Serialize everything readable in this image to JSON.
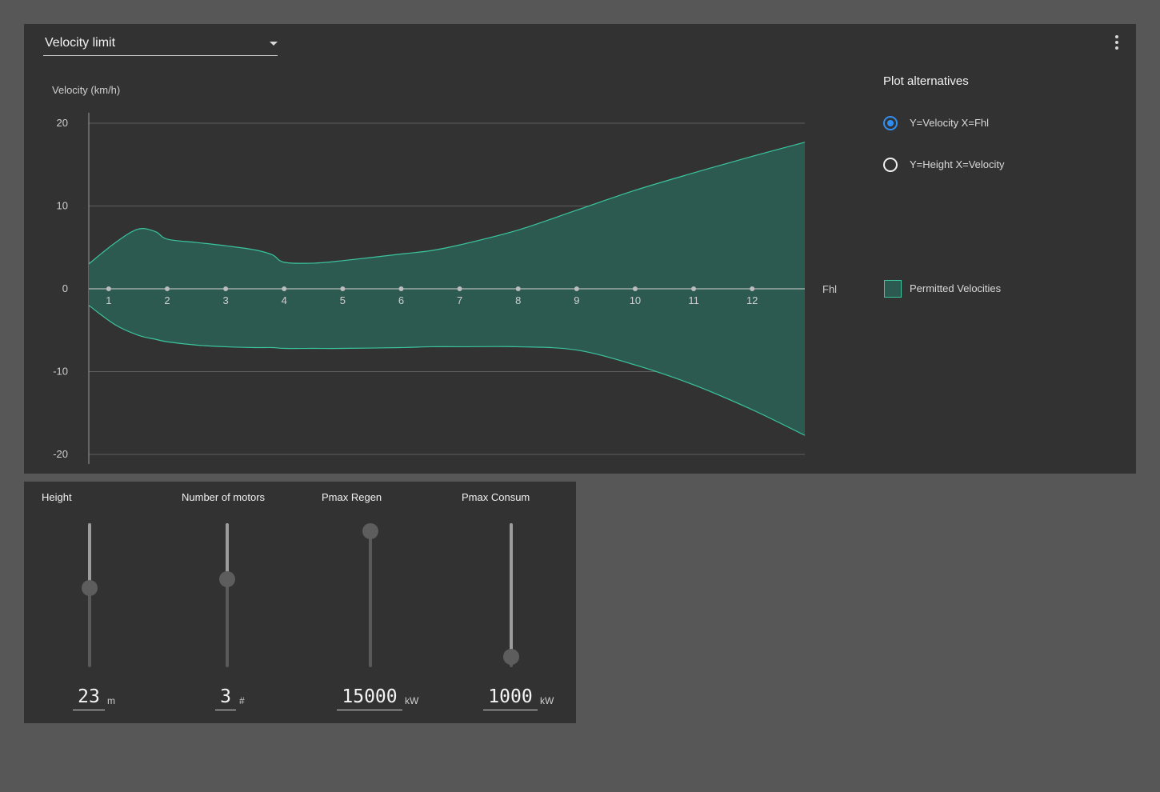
{
  "chart_selector": {
    "selected": "Velocity limit"
  },
  "menu_icon": "more-vertical-icon",
  "plot_alternatives": {
    "title": "Plot alternatives",
    "options": [
      {
        "label": "Y=Velocity X=Fhl",
        "checked": true
      },
      {
        "label": "Y=Height X=Velocity",
        "checked": false
      }
    ]
  },
  "legend": {
    "label": "Permitted Velocities",
    "color": "#2d5a50",
    "stroke": "#3ac49d"
  },
  "chart_data": {
    "type": "area",
    "ylabel": "Velocity (km/h)",
    "xlabel": "Fhl",
    "ylim": [
      -20,
      20
    ],
    "yticks": [
      20,
      10,
      0,
      -10,
      -20
    ],
    "xticks": [
      1,
      2,
      3,
      4,
      5,
      6,
      7,
      8,
      9,
      10,
      11,
      12
    ],
    "xlim": [
      0.66,
      12.9
    ],
    "grid": true,
    "series": [
      {
        "name": "Permitted Velocities",
        "x": [
          0.66,
          1.1,
          1.5,
          1.8,
          2.0,
          2.5,
          3.0,
          3.5,
          3.8,
          4.0,
          4.5,
          5.0,
          6.0,
          6.5,
          7.0,
          8.0,
          9.0,
          10.0,
          11.0,
          12.0,
          12.9
        ],
        "upper": [
          3.0,
          5.5,
          7.2,
          6.9,
          6.0,
          5.6,
          5.2,
          4.7,
          4.1,
          3.2,
          3.1,
          3.4,
          4.2,
          4.6,
          5.3,
          7.1,
          9.5,
          11.9,
          14.0,
          16.0,
          17.7
        ],
        "lower": [
          -2.0,
          -4.3,
          -5.6,
          -6.1,
          -6.4,
          -6.8,
          -7.0,
          -7.1,
          -7.1,
          -7.2,
          -7.2,
          -7.2,
          -7.1,
          -7.0,
          -7.0,
          -7.0,
          -7.4,
          -9.2,
          -11.6,
          -14.6,
          -17.7
        ]
      }
    ]
  },
  "controls": [
    {
      "label": "Height",
      "value": "23",
      "unit": "m",
      "level": 0.45
    },
    {
      "label": "Number of motors",
      "value": "3",
      "unit": "#",
      "level": 0.39
    },
    {
      "label": "Pmax Regen",
      "value": "15000",
      "unit": "kW",
      "level": 0.0
    },
    {
      "label": "Pmax Consum",
      "value": "1000",
      "unit": "kW",
      "level": 0.93
    }
  ]
}
